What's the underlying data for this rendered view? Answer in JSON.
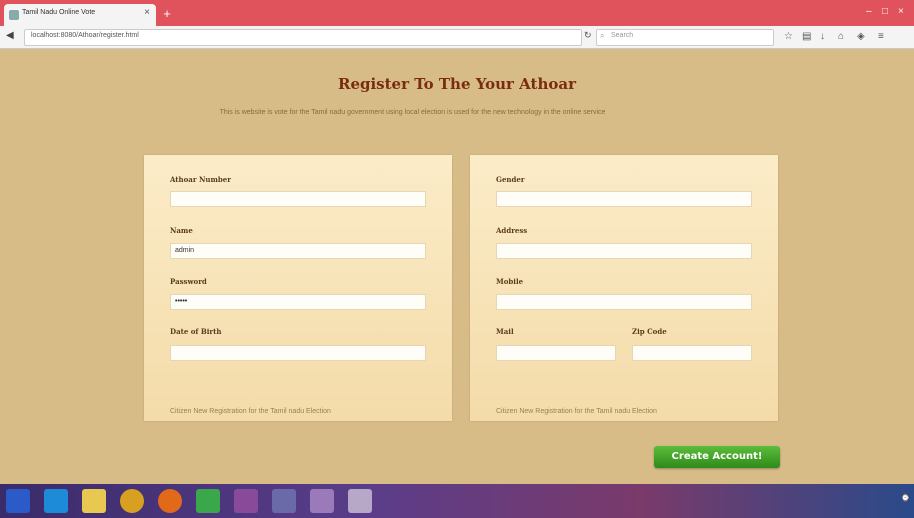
{
  "browser": {
    "tab_title": "Tamil Nadu Online Vote",
    "url": "localhost:8080/Athoar/register.html",
    "search_placeholder": "Search",
    "close_glyph": "×",
    "new_tab_glyph": "+"
  },
  "page": {
    "heading": "Register To The Your Athoar",
    "subtitle": "This is website is vote for the Tamil nadu government using local election is used for the new technology in the online service"
  },
  "left_panel": {
    "aadhaar_label": "Athoar Number",
    "aadhaar_value": "",
    "name_label": "Name",
    "name_value": "admin",
    "password_label": "Password",
    "password_value": "•••••",
    "dob_label": "Date of Birth",
    "dob_value": "",
    "footnote": "Citizen New Registration for the Tamil nadu Election"
  },
  "right_panel": {
    "gender_label": "Gender",
    "gender_value": "",
    "address_label": "Address",
    "address_value": "",
    "mobile_label": "Mobile",
    "mobile_value": "",
    "mail_label": "Mail",
    "mail_value": "",
    "zip_label": "Zip Code",
    "zip_value": "",
    "footnote": "Citizen New Registration for the Tamil nadu Election"
  },
  "actions": {
    "create_label": "Create Account!"
  },
  "colors": {
    "background": "#d8bc88",
    "heading": "#7a2d0e",
    "button": "#3f9e24",
    "titlebar": "#e0525c"
  },
  "icons": [
    "back-icon",
    "reload-icon",
    "search-icon",
    "star-icon",
    "bookmarks-icon",
    "download-icon",
    "home-icon",
    "shield-icon",
    "menu-icon",
    "start-icon"
  ]
}
